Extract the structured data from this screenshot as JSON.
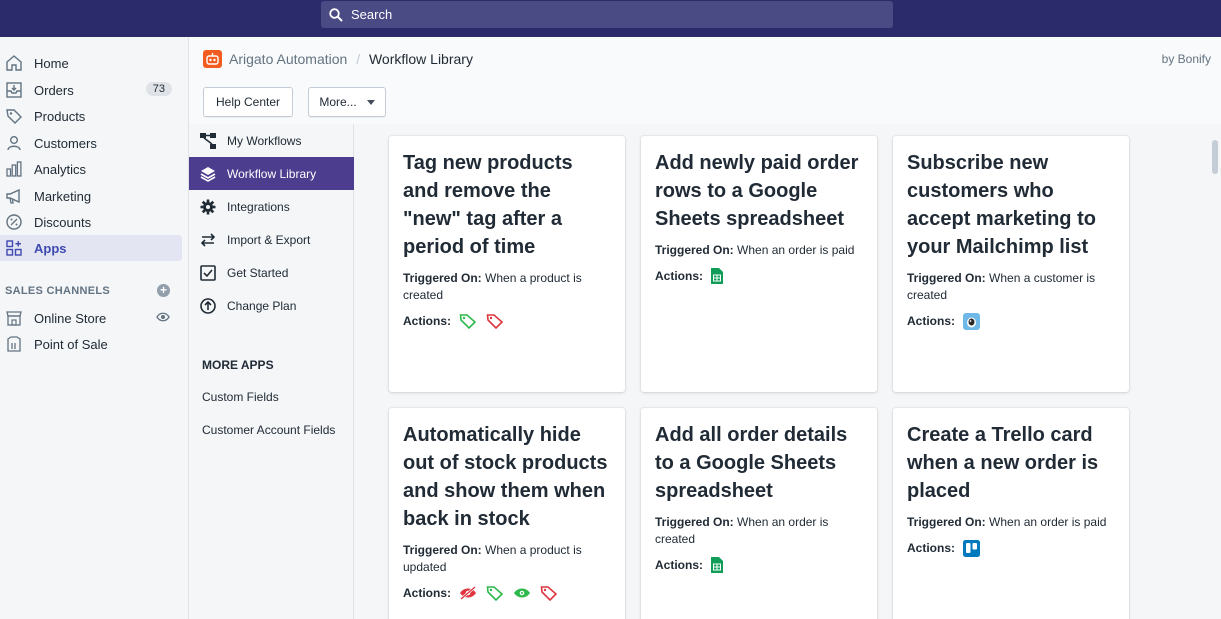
{
  "search": {
    "placeholder": "Search"
  },
  "sidebar": {
    "items": [
      {
        "label": "Home"
      },
      {
        "label": "Orders",
        "badge": "73"
      },
      {
        "label": "Products"
      },
      {
        "label": "Customers"
      },
      {
        "label": "Analytics"
      },
      {
        "label": "Marketing"
      },
      {
        "label": "Discounts"
      },
      {
        "label": "Apps"
      }
    ],
    "channels_header": "SALES CHANNELS",
    "channels": [
      {
        "label": "Online Store"
      },
      {
        "label": "Point of Sale"
      }
    ]
  },
  "app": {
    "breadcrumb_parent": "Arigato Automation",
    "breadcrumb_separator": "/",
    "breadcrumb_current": "Workflow Library",
    "byline": "by Bonify",
    "help_button": "Help Center",
    "more_button": "More..."
  },
  "subnav": {
    "items": [
      {
        "label": "My Workflows"
      },
      {
        "label": "Workflow Library"
      },
      {
        "label": "Integrations"
      },
      {
        "label": "Import & Export"
      },
      {
        "label": "Get Started"
      },
      {
        "label": "Change Plan"
      }
    ],
    "more_apps_header": "MORE APPS",
    "more_apps": [
      {
        "label": "Custom Fields"
      },
      {
        "label": "Customer Account Fields"
      }
    ]
  },
  "labels": {
    "triggered_on": "Triggered On:",
    "actions": "Actions:"
  },
  "cards": [
    {
      "title": "Tag new products and remove the \"new\" tag after a period of time",
      "trigger": "When a product is created"
    },
    {
      "title": "Add newly paid order rows to a Google Sheets spreadsheet",
      "trigger": "When an order is paid"
    },
    {
      "title": "Subscribe new customers who accept marketing to your Mailchimp list",
      "trigger": "When a customer is created"
    },
    {
      "title": "Automatically hide out of stock products and show them when back in stock",
      "trigger": "When a product is updated"
    },
    {
      "title": "Add all order details to a Google Sheets spreadsheet",
      "trigger": "When an order is created"
    },
    {
      "title": "Create a Trello card when a new order is placed",
      "trigger": "When an order is paid"
    }
  ],
  "colors": {
    "topbar": "#2b2a6a",
    "accent": "#4d3d8e",
    "tag_green": "#2db84c",
    "tag_red": "#e0353f",
    "sheets_green": "#0f9d58",
    "trello_blue": "#0079bf"
  }
}
